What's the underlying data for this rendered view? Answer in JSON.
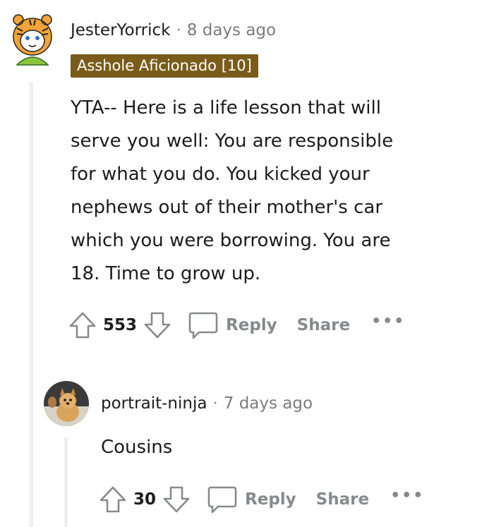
{
  "comments": [
    {
      "username": "JesterYorrick",
      "separator": "·",
      "time": "8 days ago",
      "flair": "Asshole Aficionado [10]",
      "avatar": "tiger-snoo-avatar",
      "body": "YTA-- Here is a life lesson that will serve you well: You are responsible for what you do. You kicked your nephews out of their mother's car which you were borrowing. You are 18. Time to grow up.",
      "body_lines": [
        "YTA-- Here is a life lesson that will",
        "serve you well: You are responsible",
        "for what you do. You kicked your",
        "nephews out of their mother's car",
        "which you were borrowing. You are",
        "18. Time to grow up."
      ],
      "score": "553",
      "reply_label": "Reply",
      "share_label": "Share",
      "more_label": "•••"
    },
    {
      "username": "portrait-ninja",
      "separator": "·",
      "time": "7 days ago",
      "avatar": "dog-photo-avatar",
      "body": "Cousins",
      "score": "30",
      "reply_label": "Reply",
      "share_label": "Share",
      "more_label": "•••"
    }
  ],
  "colors": {
    "flair_bg": "#7a5c1a",
    "thread_line": "#edeff1",
    "muted": "#878a8c"
  },
  "icons": [
    "upvote-icon",
    "downvote-icon",
    "comment-bubble-icon",
    "more-options-icon"
  ]
}
